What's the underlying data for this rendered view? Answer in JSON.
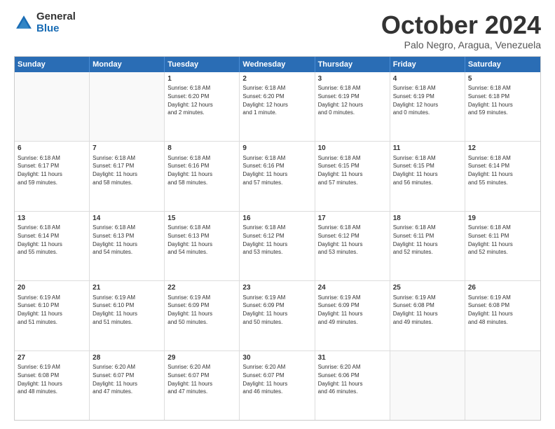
{
  "logo": {
    "general": "General",
    "blue": "Blue"
  },
  "title": "October 2024",
  "location": "Palo Negro, Aragua, Venezuela",
  "header_days": [
    "Sunday",
    "Monday",
    "Tuesday",
    "Wednesday",
    "Thursday",
    "Friday",
    "Saturday"
  ],
  "weeks": [
    [
      {
        "day": "",
        "info": ""
      },
      {
        "day": "",
        "info": ""
      },
      {
        "day": "1",
        "info": "Sunrise: 6:18 AM\nSunset: 6:20 PM\nDaylight: 12 hours\nand 2 minutes."
      },
      {
        "day": "2",
        "info": "Sunrise: 6:18 AM\nSunset: 6:20 PM\nDaylight: 12 hours\nand 1 minute."
      },
      {
        "day": "3",
        "info": "Sunrise: 6:18 AM\nSunset: 6:19 PM\nDaylight: 12 hours\nand 0 minutes."
      },
      {
        "day": "4",
        "info": "Sunrise: 6:18 AM\nSunset: 6:19 PM\nDaylight: 12 hours\nand 0 minutes."
      },
      {
        "day": "5",
        "info": "Sunrise: 6:18 AM\nSunset: 6:18 PM\nDaylight: 11 hours\nand 59 minutes."
      }
    ],
    [
      {
        "day": "6",
        "info": "Sunrise: 6:18 AM\nSunset: 6:17 PM\nDaylight: 11 hours\nand 59 minutes."
      },
      {
        "day": "7",
        "info": "Sunrise: 6:18 AM\nSunset: 6:17 PM\nDaylight: 11 hours\nand 58 minutes."
      },
      {
        "day": "8",
        "info": "Sunrise: 6:18 AM\nSunset: 6:16 PM\nDaylight: 11 hours\nand 58 minutes."
      },
      {
        "day": "9",
        "info": "Sunrise: 6:18 AM\nSunset: 6:16 PM\nDaylight: 11 hours\nand 57 minutes."
      },
      {
        "day": "10",
        "info": "Sunrise: 6:18 AM\nSunset: 6:15 PM\nDaylight: 11 hours\nand 57 minutes."
      },
      {
        "day": "11",
        "info": "Sunrise: 6:18 AM\nSunset: 6:15 PM\nDaylight: 11 hours\nand 56 minutes."
      },
      {
        "day": "12",
        "info": "Sunrise: 6:18 AM\nSunset: 6:14 PM\nDaylight: 11 hours\nand 55 minutes."
      }
    ],
    [
      {
        "day": "13",
        "info": "Sunrise: 6:18 AM\nSunset: 6:14 PM\nDaylight: 11 hours\nand 55 minutes."
      },
      {
        "day": "14",
        "info": "Sunrise: 6:18 AM\nSunset: 6:13 PM\nDaylight: 11 hours\nand 54 minutes."
      },
      {
        "day": "15",
        "info": "Sunrise: 6:18 AM\nSunset: 6:13 PM\nDaylight: 11 hours\nand 54 minutes."
      },
      {
        "day": "16",
        "info": "Sunrise: 6:18 AM\nSunset: 6:12 PM\nDaylight: 11 hours\nand 53 minutes."
      },
      {
        "day": "17",
        "info": "Sunrise: 6:18 AM\nSunset: 6:12 PM\nDaylight: 11 hours\nand 53 minutes."
      },
      {
        "day": "18",
        "info": "Sunrise: 6:18 AM\nSunset: 6:11 PM\nDaylight: 11 hours\nand 52 minutes."
      },
      {
        "day": "19",
        "info": "Sunrise: 6:18 AM\nSunset: 6:11 PM\nDaylight: 11 hours\nand 52 minutes."
      }
    ],
    [
      {
        "day": "20",
        "info": "Sunrise: 6:19 AM\nSunset: 6:10 PM\nDaylight: 11 hours\nand 51 minutes."
      },
      {
        "day": "21",
        "info": "Sunrise: 6:19 AM\nSunset: 6:10 PM\nDaylight: 11 hours\nand 51 minutes."
      },
      {
        "day": "22",
        "info": "Sunrise: 6:19 AM\nSunset: 6:09 PM\nDaylight: 11 hours\nand 50 minutes."
      },
      {
        "day": "23",
        "info": "Sunrise: 6:19 AM\nSunset: 6:09 PM\nDaylight: 11 hours\nand 50 minutes."
      },
      {
        "day": "24",
        "info": "Sunrise: 6:19 AM\nSunset: 6:09 PM\nDaylight: 11 hours\nand 49 minutes."
      },
      {
        "day": "25",
        "info": "Sunrise: 6:19 AM\nSunset: 6:08 PM\nDaylight: 11 hours\nand 49 minutes."
      },
      {
        "day": "26",
        "info": "Sunrise: 6:19 AM\nSunset: 6:08 PM\nDaylight: 11 hours\nand 48 minutes."
      }
    ],
    [
      {
        "day": "27",
        "info": "Sunrise: 6:19 AM\nSunset: 6:08 PM\nDaylight: 11 hours\nand 48 minutes."
      },
      {
        "day": "28",
        "info": "Sunrise: 6:20 AM\nSunset: 6:07 PM\nDaylight: 11 hours\nand 47 minutes."
      },
      {
        "day": "29",
        "info": "Sunrise: 6:20 AM\nSunset: 6:07 PM\nDaylight: 11 hours\nand 47 minutes."
      },
      {
        "day": "30",
        "info": "Sunrise: 6:20 AM\nSunset: 6:07 PM\nDaylight: 11 hours\nand 46 minutes."
      },
      {
        "day": "31",
        "info": "Sunrise: 6:20 AM\nSunset: 6:06 PM\nDaylight: 11 hours\nand 46 minutes."
      },
      {
        "day": "",
        "info": ""
      },
      {
        "day": "",
        "info": ""
      }
    ]
  ]
}
